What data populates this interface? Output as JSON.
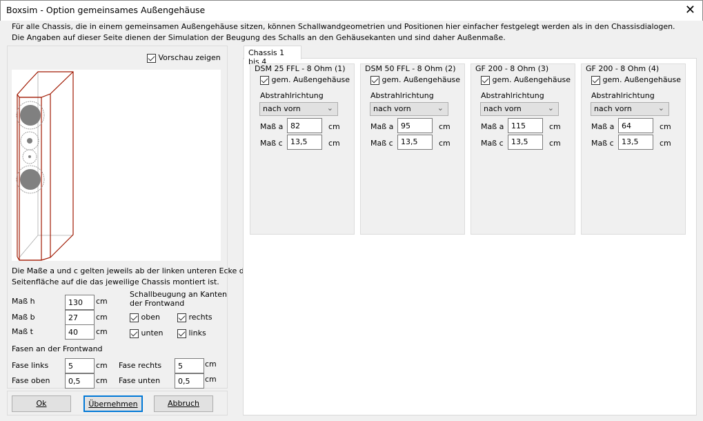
{
  "window": {
    "title": "Boxsim - Option gemeinsames Außengehäuse",
    "close": "✕"
  },
  "info": [
    "Für alle Chassis, die in einem gemeinsamen Außengehäuse sitzen, können Schallwandgeometrien und Positionen hier einfacher festgelegt werden als in den Chassisdialogen.",
    "Die Angaben auf dieser Seite dienen der Simulation der  Beugung des Schalls an den Gehäusekanten und sind daher Außenmaße."
  ],
  "left": {
    "preview_label": "Vorschau zeigen",
    "note": [
      "Die Maße a und c gelten jeweils ab der linken unteren Ecke der",
      "Seitenfläche auf die das jeweilige Chassis montiert ist."
    ],
    "dims": [
      {
        "label": "Maß h",
        "value": "130",
        "unit": "cm"
      },
      {
        "label": "Maß b",
        "value": "27",
        "unit": "cm"
      },
      {
        "label": "Maß t",
        "value": "40",
        "unit": "cm"
      }
    ],
    "diffraction_title": [
      "Schallbeugung an Kanten",
      "der Frontwand"
    ],
    "edges": {
      "oben": "oben",
      "rechts": "rechts",
      "unten": "unten",
      "links": "links"
    },
    "fasen_title": "Fasen an der Frontwand",
    "fasen": [
      {
        "label": "Fase links",
        "value": "5",
        "unit": "cm"
      },
      {
        "label": "Fase rechts",
        "value": "5",
        "unit": "cm"
      },
      {
        "label": "Fase oben",
        "value": "0,5",
        "unit": "cm"
      },
      {
        "label": "Fase unten",
        "value": "0,5",
        "unit": "cm"
      }
    ]
  },
  "buttons": {
    "ok": "Ok",
    "apply": "Übernehmen",
    "cancel": "Abbruch"
  },
  "tab": "Chassis 1 bis 4",
  "chassis": [
    {
      "title": "DSM 25 FFL - 8 Ohm (1)",
      "check": "gem. Außengehäuse",
      "dir_label": "Abstrahlrichtung",
      "dir": "nach vorn",
      "a_label": "Maß a",
      "a": "82",
      "c_label": "Maß c",
      "c": "13,5",
      "unit": "cm"
    },
    {
      "title": "DSM 50 FFL - 8 Ohm (2)",
      "check": "gem. Außengehäuse",
      "dir_label": "Abstrahlrichtung",
      "dir": "nach vorn",
      "a_label": "Maß a",
      "a": "95",
      "c_label": "Maß c",
      "c": "13,5",
      "unit": "cm"
    },
    {
      "title": "GF 200 - 8 Ohm (3)",
      "check": "gem. Außengehäuse",
      "dir_label": "Abstrahlrichtung",
      "dir": "nach vorn",
      "a_label": "Maß a",
      "a": "115",
      "c_label": "Maß c",
      "c": "13,5",
      "unit": "cm"
    },
    {
      "title": "GF 200 - 8 Ohm (4)",
      "check": "gem. Außengehäuse",
      "dir_label": "Abstrahlrichtung",
      "dir": "nach vorn",
      "a_label": "Maß a",
      "a": "64",
      "c_label": "Maß c",
      "c": "13,5",
      "unit": "cm"
    }
  ]
}
